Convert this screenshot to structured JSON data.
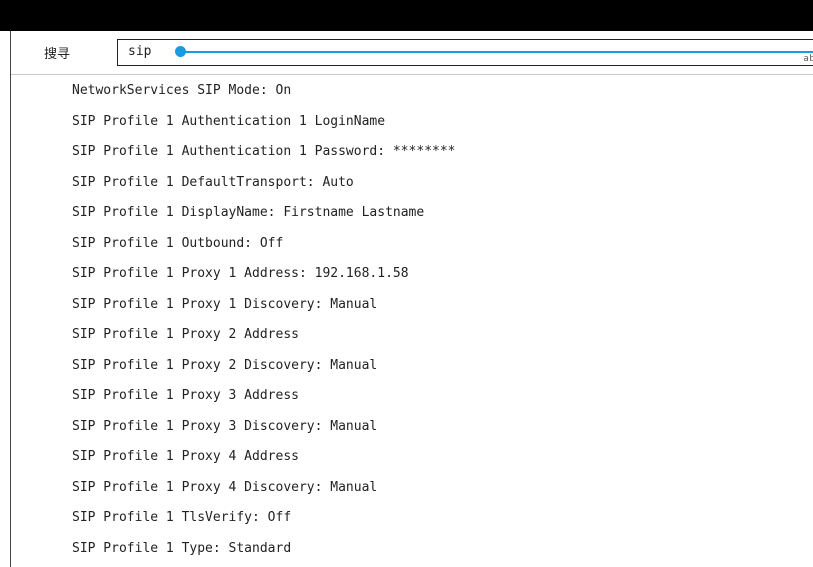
{
  "search": {
    "label": "搜寻",
    "query": "sip",
    "keyboard_mode": "abc",
    "accent_color": "#1a9be0"
  },
  "results": [
    "NetworkServices SIP Mode: On",
    "SIP Profile 1 Authentication 1 LoginName",
    "SIP Profile 1 Authentication 1 Password: ********",
    "SIP Profile 1 DefaultTransport: Auto",
    "SIP Profile 1 DisplayName: Firstname Lastname",
    "SIP Profile 1 Outbound: Off",
    "SIP Profile 1 Proxy 1 Address: 192.168.1.58",
    "SIP Profile 1 Proxy 1 Discovery: Manual",
    "SIP Profile 1 Proxy 2 Address",
    "SIP Profile 1 Proxy 2 Discovery: Manual",
    "SIP Profile 1 Proxy 3 Address",
    "SIP Profile 1 Proxy 3 Discovery: Manual",
    "SIP Profile 1 Proxy 4 Address",
    "SIP Profile 1 Proxy 4 Discovery: Manual",
    "SIP Profile 1 TlsVerify: Off",
    "SIP Profile 1 Type: Standard"
  ]
}
